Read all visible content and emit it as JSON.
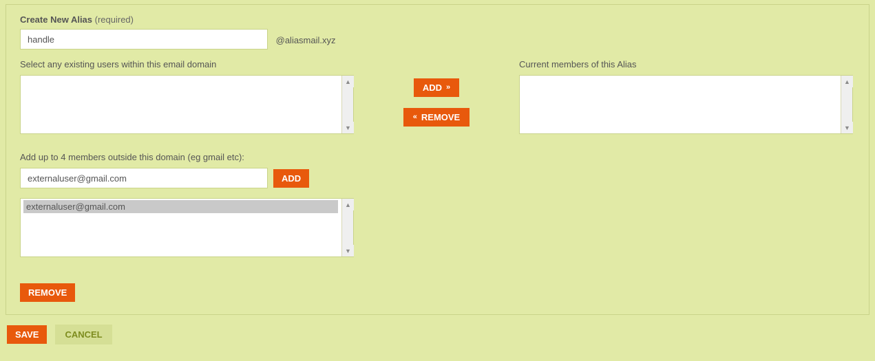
{
  "section": {
    "title": "Create New Alias",
    "required": "(required)"
  },
  "alias": {
    "input": "handle",
    "domain_suffix": "@aliasmail.xyz"
  },
  "existing": {
    "label": "Select any existing users within this email domain",
    "items": []
  },
  "transfer": {
    "add_label": "ADD",
    "remove_label": "REMOVE"
  },
  "members": {
    "label": "Current members of this Alias",
    "items": []
  },
  "external": {
    "label": "Add up to 4 members outside this domain (eg gmail etc):",
    "input": "externaluser@gmail.com",
    "add_label": "ADD",
    "items": [
      "externaluser@gmail.com"
    ],
    "remove_label": "REMOVE"
  },
  "footer": {
    "save": "SAVE",
    "cancel": "CANCEL"
  }
}
